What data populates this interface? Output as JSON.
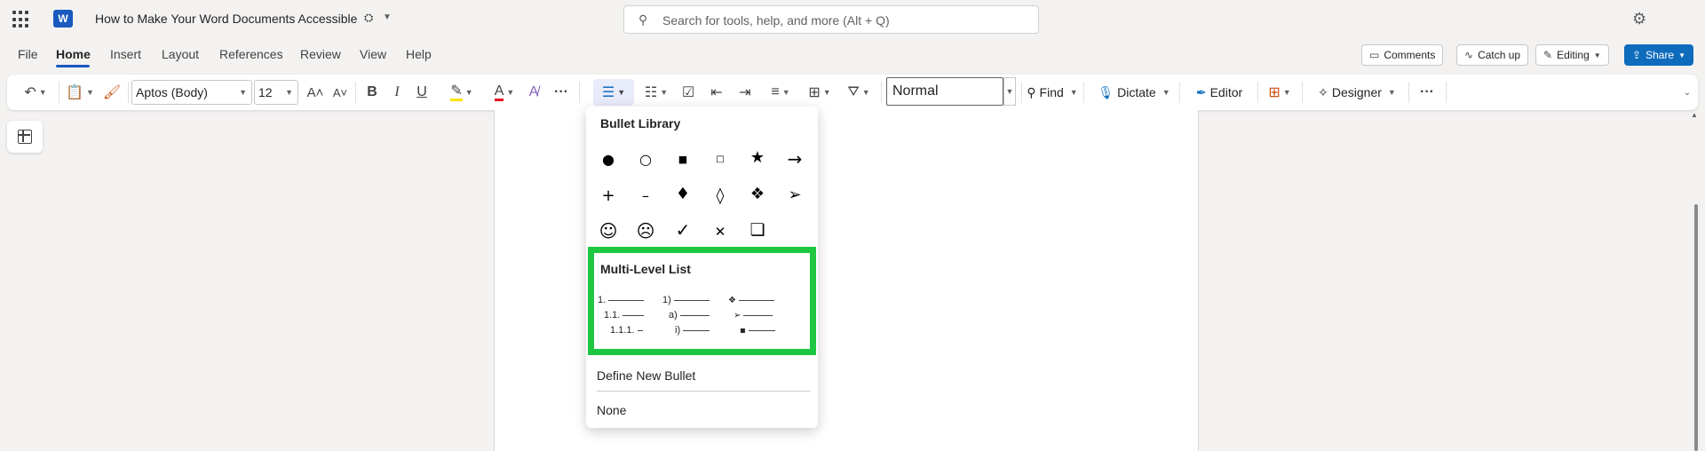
{
  "title_bar": {
    "app_icon": "word-icon",
    "doc_title": "How to Make Your Word Documents Accessible",
    "search_placeholder": "Search for tools, help, and more (Alt + Q)"
  },
  "menu": {
    "tabs": [
      "File",
      "Home",
      "Insert",
      "Layout",
      "References",
      "Review",
      "View",
      "Help"
    ],
    "active_tab": "Home",
    "comments_label": "Comments",
    "catchup_label": "Catch up",
    "editing_label": "Editing",
    "share_label": "Share"
  },
  "ribbon": {
    "font_name": "Aptos (Body)",
    "font_size": "12",
    "style_name": "Normal",
    "find_label": "Find",
    "dictate_label": "Dictate",
    "editor_label": "Editor",
    "designer_label": "Designer"
  },
  "bullet_menu": {
    "library_heading": "Bullet Library",
    "bullets": [
      "●",
      "○",
      "■",
      "□",
      "★",
      "→",
      "+",
      "–",
      "♦",
      "◊",
      "❖",
      "➢",
      "☺",
      "☹",
      "✓",
      "✕",
      "❏"
    ],
    "multilevel_heading": "Multi-Level List",
    "multilevel_options": [
      [
        "1.",
        "1.1.",
        "1.1.1."
      ],
      [
        "1)",
        "a)",
        "i)"
      ],
      [
        "❖",
        "➢",
        "▪"
      ]
    ],
    "define_label": "Define New Bullet",
    "none_label": "None"
  },
  "colors": {
    "accent": "#185abd",
    "share_bg": "#0f6cbd",
    "highlight_border": "#1ec741",
    "font_color_bar": "#e81123"
  }
}
